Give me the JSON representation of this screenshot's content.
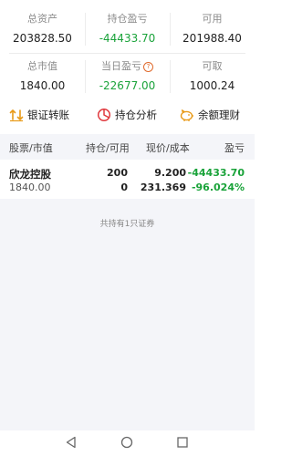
{
  "summary": {
    "total_assets": {
      "label": "总资产",
      "value": "203828.50"
    },
    "position_pnl": {
      "label": "持仓盈亏",
      "value": "-44433.70"
    },
    "available": {
      "label": "可用",
      "value": "201988.40"
    },
    "market_value": {
      "label": "总市值",
      "value": "1840.00"
    },
    "today_pnl": {
      "label": "当日盈亏",
      "value": "-22677.00",
      "help_icon": "question-icon"
    },
    "withdrawable": {
      "label": "可取",
      "value": "1000.24"
    }
  },
  "actions": [
    {
      "label": "银证转账",
      "icon": "transfer-icon",
      "color": "#e89a18"
    },
    {
      "label": "持仓分析",
      "icon": "pie-chart-icon",
      "color": "#e0393e"
    },
    {
      "label": "余额理财",
      "icon": "piggy-bank-icon",
      "color": "#e89a18"
    }
  ],
  "table": {
    "headers": [
      "股票/市值",
      "持仓/可用",
      "现价/成本",
      "盈亏"
    ],
    "rows": [
      {
        "name": "欣龙控股",
        "market_value": "1840.00",
        "position": "200",
        "available": "0",
        "price": "9.200",
        "cost": "231.369",
        "pnl": "-44433.70",
        "pnl_pct": "-96.024%"
      }
    ],
    "footer": "共持有1只证券"
  },
  "colors": {
    "green": "#1aa33a",
    "orange": "#e89a18",
    "red": "#e0393e",
    "bg_gray": "#f4f5f9"
  },
  "nav": {
    "back_icon": "back-triangle-icon",
    "home_icon": "home-circle-icon",
    "recent_icon": "recent-square-icon"
  }
}
